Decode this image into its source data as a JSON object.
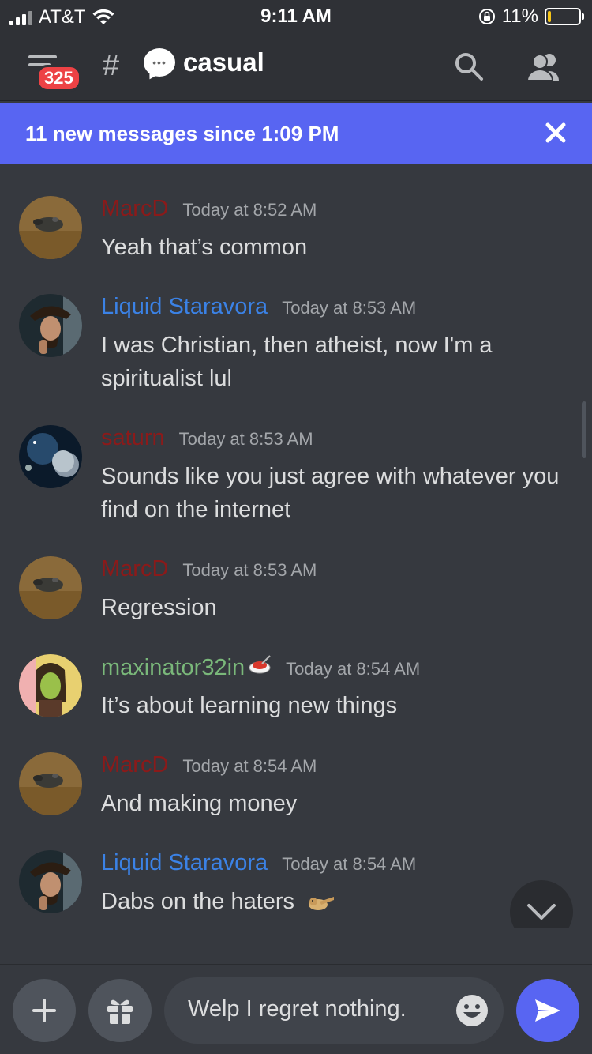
{
  "status_bar": {
    "carrier": "AT&T",
    "time": "9:11 AM",
    "battery": "11%",
    "battery_level": 0.11
  },
  "header": {
    "badge": "325",
    "hash": "#",
    "channel_name": "casual"
  },
  "new_messages_bar": {
    "text": "11 new messages since 1:09 PM"
  },
  "messages": [
    {
      "author": "MarcD",
      "author_color": "#8b1a1a",
      "time": "Today at 8:52 AM",
      "text": "Yeah that’s common"
    },
    {
      "author": "Liquid Staravora",
      "author_color": "#3b82e6",
      "time": "Today at 8:53 AM",
      "text": "I was Christian, then atheist, now I'm a spiritualist lul"
    },
    {
      "author": "saturn",
      "author_color": "#8b1a1a",
      "time": "Today at 8:53 AM",
      "text": "Sounds like you just agree with whatever you find on the internet"
    },
    {
      "author": "MarcD",
      "author_color": "#8b1a1a",
      "time": "Today at 8:53 AM",
      "text": "Regression"
    },
    {
      "author": "maxinator32in",
      "author_color": "#7ab87a",
      "time": "Today at 8:54 AM",
      "text": "It’s about learning new things"
    },
    {
      "author": "MarcD",
      "author_color": "#8b1a1a",
      "time": "Today at 8:54 AM",
      "text": "And making money"
    },
    {
      "author": "Liquid Staravora",
      "author_color": "#3b82e6",
      "time": "Today at 8:54 AM",
      "text": "Dabs on the haters"
    }
  ],
  "composer": {
    "input_value": "Welp I regret nothing."
  },
  "colors": {
    "background": "#36393f",
    "header": "#2f3136",
    "blurple": "#5865f2",
    "badge": "#ed4245"
  },
  "icons": [
    "menu-icon",
    "search-icon",
    "members-icon",
    "close-icon",
    "chevron-down-icon",
    "plus-icon",
    "gift-icon",
    "emoji-icon",
    "send-icon"
  ]
}
